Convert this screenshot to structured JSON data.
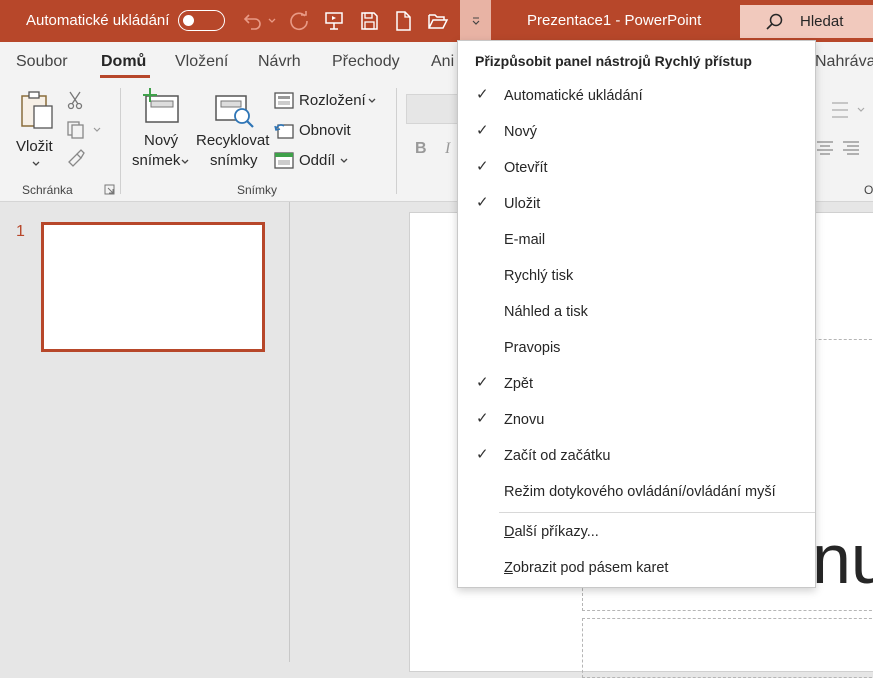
{
  "titlebar": {
    "autosave_label": "Automatické ukládání",
    "window_title": "Prezentace1  -  PowerPoint",
    "search_label": "Hledat",
    "accent_color": "#b7472a"
  },
  "tabs": [
    "Soubor",
    "Domů",
    "Vložení",
    "Návrh",
    "Přechody",
    "Ani",
    "Nahráva"
  ],
  "active_tab": "Domů",
  "ribbon": {
    "paste_label": "Vložit",
    "clipboard_group": "Schránka",
    "new_slide_line1": "Nový",
    "new_slide_line2": "snímek",
    "reuse_line1": "Recyklovat",
    "reuse_line2": "snímky",
    "layout_label": "Rozložení",
    "reset_label": "Obnovit",
    "section_label": "Oddíl",
    "slides_group": "Snímky",
    "bold_label": "B",
    "italic_label": "I",
    "paragraph_group_partial": "O"
  },
  "thumbnails": {
    "slide_number": "1"
  },
  "dropdown": {
    "header": "Přizpůsobit panel nástrojů Rychlý přístup",
    "items": [
      {
        "label": "Automatické ukládání",
        "checked": "✓"
      },
      {
        "label": "Nový",
        "checked": "✓"
      },
      {
        "label": "Otevřít",
        "checked": "✓"
      },
      {
        "label": "Uložit",
        "checked": "✓"
      },
      {
        "label": "E-mail",
        "checked": ""
      },
      {
        "label": "Rychlý tisk",
        "checked": ""
      },
      {
        "label": "Náhled a tisk",
        "checked": ""
      },
      {
        "label": "Pravopis",
        "checked": ""
      },
      {
        "label": "Zpět",
        "checked": "✓"
      },
      {
        "label": "Znovu",
        "checked": "✓"
      },
      {
        "label": "Začít od začátku",
        "checked": "✓"
      },
      {
        "label": "Režim dotykového ovládání/ovládání myší",
        "checked": ""
      }
    ],
    "more_commands": "Další příkazy...",
    "show_below_ribbon": "Zobrazit pod pásem karet"
  },
  "slide": {
    "visible_title_fragment": "nu"
  }
}
